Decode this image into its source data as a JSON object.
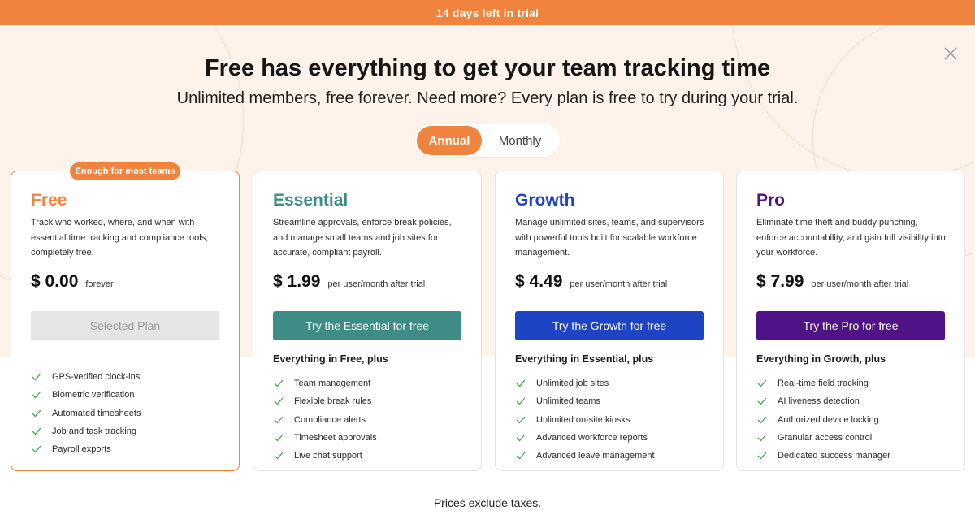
{
  "trial_banner": "14 days left in trial",
  "headline": "Free has everything to get your team tracking time",
  "subheadline": "Unlimited members, free forever. Need more? Every plan is free to try during your trial.",
  "billing_toggle": {
    "annual": "Annual",
    "monthly": "Monthly",
    "selected": "Annual"
  },
  "colors": {
    "accent": "#f0843e",
    "free": "#f0843e",
    "essential": "#3d8c86",
    "growth": "#1f44c3",
    "pro": "#4f1387"
  },
  "plans": [
    {
      "badge": "Enough for most teams",
      "name": "Free",
      "description": "Track who worked, where, and when with essential time tracking and compliance tools, completely free.",
      "price": "$ 0.00",
      "period": "forever",
      "cta": "Selected Plan",
      "includes": "",
      "features": [
        "GPS-verified clock-ins",
        "Biometric verification",
        "Automated timesheets",
        "Job and task tracking",
        "Payroll exports"
      ]
    },
    {
      "name": "Essential",
      "description": "Streamline approvals, enforce break policies, and manage small teams and job sites for accurate, compliant payroll.",
      "price": "$ 1.99",
      "period": "per user/month after trial",
      "cta": "Try the Essential for free",
      "includes": "Everything in Free, plus",
      "features": [
        "Team management",
        "Flexible break rules",
        "Compliance alerts",
        "Timesheet approvals",
        "Live chat support"
      ]
    },
    {
      "name": "Growth",
      "description": "Manage unlimited sites, teams, and supervisors with powerful tools built for scalable workforce management.",
      "price": "$ 4.49",
      "period": "per user/month after trial",
      "cta": "Try the Growth for free",
      "includes": "Everything in Essential, plus",
      "features": [
        "Unlimited job sites",
        "Unlimited teams",
        "Unlimited on-site kiosks",
        "Advanced workforce reports",
        "Advanced leave management"
      ]
    },
    {
      "name": "Pro",
      "description": "Eliminate time theft and buddy punching, enforce accountability, and gain full visibility into your workforce.",
      "price": "$ 7.99",
      "period": "per user/month after trial",
      "cta": "Try the Pro for free",
      "includes": "Everything in Growth, plus",
      "features": [
        "Real-time field tracking",
        "AI liveness detection",
        "Authorized device locking",
        "Granular access control",
        "Dedicated success manager"
      ]
    }
  ],
  "footer_note": "Prices exclude taxes."
}
